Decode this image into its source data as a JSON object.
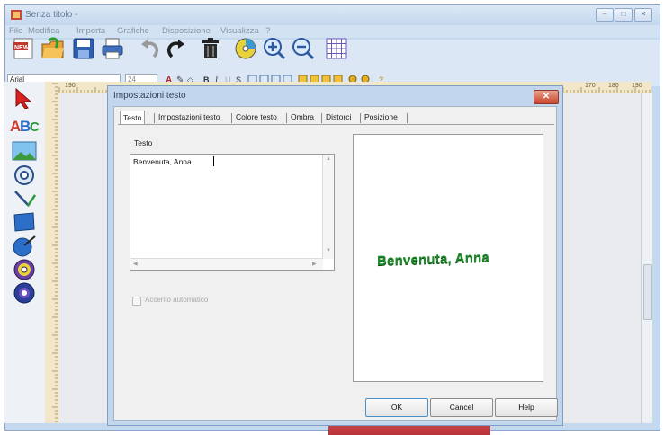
{
  "window": {
    "title": "Senza titolo -"
  },
  "menu": [
    "File",
    "Modifica",
    "Importa",
    "Grafiche",
    "Disposizione",
    "Visualizza",
    "?"
  ],
  "format_bar": {
    "font": "Arial",
    "size": "24"
  },
  "ruler": {
    "left_marks": [
      "190"
    ],
    "right_marks": [
      "170",
      "180",
      "190"
    ]
  },
  "dialog": {
    "title": "Impostazioni testo",
    "tabs": [
      "Testo",
      "Impostazioni testo",
      "Colore testo",
      "Ombra",
      "Distorci",
      "Posizione"
    ],
    "active_tab": "Testo",
    "text_label": "Testo",
    "text_value": "Benvenuta, Anna",
    "checkbox_label": "Accento automatico",
    "preview_text": "Benvenuta, Anna",
    "buttons": {
      "ok": "OK",
      "cancel": "Cancel",
      "help": "Help"
    }
  },
  "colors": {
    "preview_text": "#1f8a2a",
    "title_bg": "#c5d9ee",
    "close_button": "#c8432c"
  },
  "tools": [
    "new-icon",
    "open-icon",
    "save-icon",
    "print-icon",
    "undo-icon",
    "redo-icon",
    "trash-icon",
    "cd-icon",
    "zoom-in-icon",
    "zoom-out-icon",
    "grid-icon"
  ],
  "side_tools": [
    "pointer-icon",
    "text-tool-icon",
    "image-tool-icon",
    "disc-tool-icon",
    "line-tool-icon",
    "rectangle-tool-icon",
    "pen-circle-icon",
    "disc-label-icon",
    "dvd-icon"
  ]
}
